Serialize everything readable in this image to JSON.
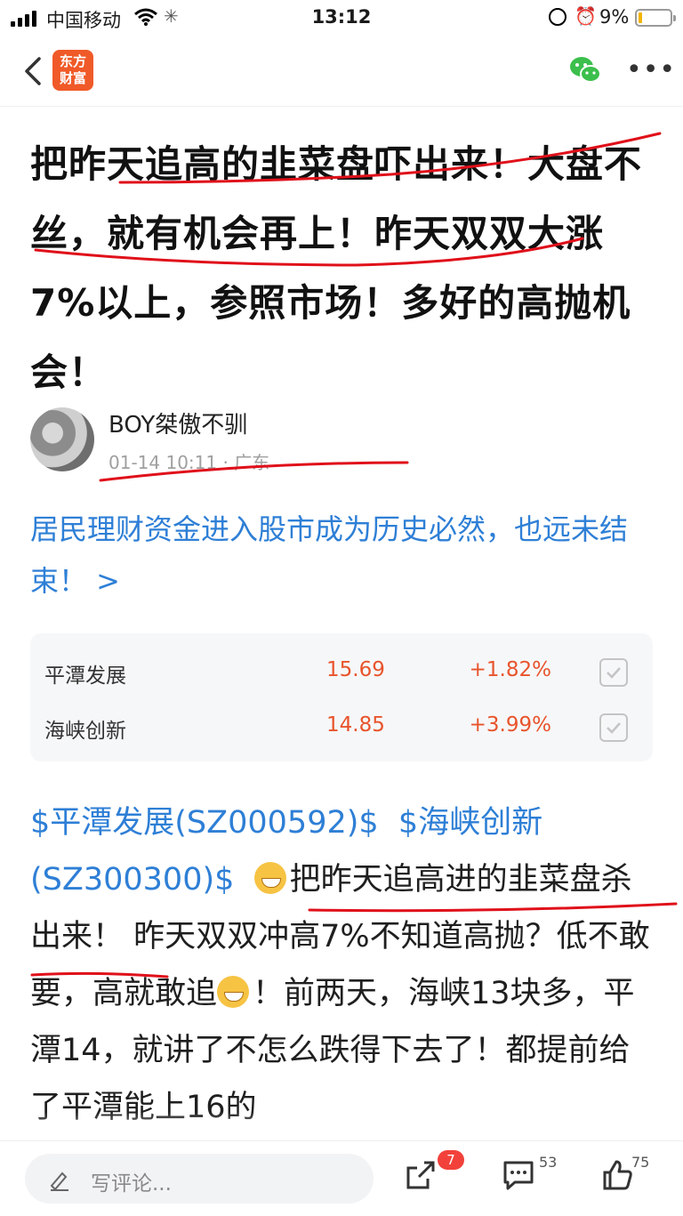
{
  "status_bar": {
    "carrier": "中国移动",
    "time": "13:12",
    "battery": "9%"
  },
  "nav": {
    "logo_line1": "东方",
    "logo_line2": "财富"
  },
  "article": {
    "title": "把昨天追高的韭菜盘吓出来！大盘不丝，就有机会再上！昨天双双大涨7%以上，参照市场！多好的高抛机会！",
    "author": "BOY桀傲不驯",
    "time": "01-14 10:11",
    "region": "广东",
    "topic_link": "居民理财资金进入股市成为历史必然，也远未结束！ >",
    "stocks": [
      {
        "name": "平潭发展",
        "price": "15.69",
        "change": "+1.82%"
      },
      {
        "name": "海峡创新",
        "price": "14.85",
        "change": "+3.99%"
      }
    ],
    "body_stock1": "$平潭发展(SZ000592)$",
    "body_stock2": "$海峡创新(SZ300300)$",
    "body_text1": "把昨天追高进的韭菜盘杀出来！ 昨天双双冲高7%不知道高抛？低不敢要，高就敢追",
    "body_text2": "！前两天，海峡13块多，平潭14，就讲了不怎么跌得下去了！都提前给了平潭能上16的"
  },
  "bottom_bar": {
    "comment_placeholder": "写评论...",
    "share_badge": "7",
    "comment_count": "53",
    "like_count": "75"
  },
  "colors": {
    "link": "#2e7fd6",
    "price": "#e8542c",
    "brand": "#f05a28",
    "annotation": "#e0101a"
  }
}
